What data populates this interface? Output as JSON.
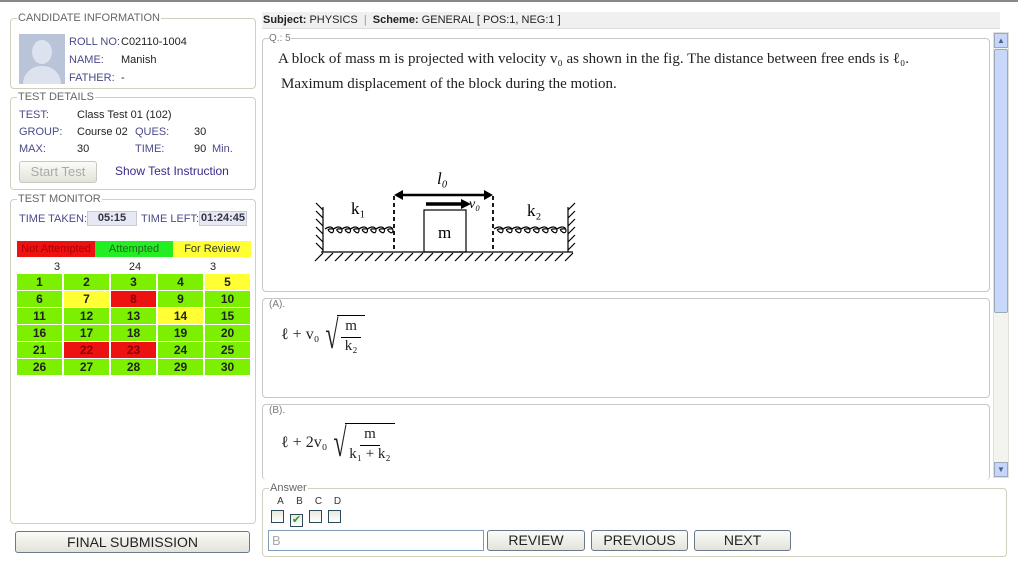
{
  "candidate": {
    "legend": "CANDIDATE INFORMATION",
    "roll_label": "ROLL NO:",
    "roll": "C02110-1004",
    "name_label": "NAME:",
    "name": "Manish",
    "father_label": "FATHER:",
    "father": "-"
  },
  "test": {
    "legend": "TEST DETAILS",
    "test_label": "TEST:",
    "test": "Class Test 01 (102)",
    "group_label": "GROUP:",
    "group": "Course 02",
    "ques_label": "QUES:",
    "ques": "30",
    "max_label": "MAX:",
    "max": "30",
    "time_label": "TIME:",
    "time": "90",
    "time_unit": "Min.",
    "start_button": "Start Test",
    "instruction_link": "Show Test Instruction"
  },
  "monitor": {
    "legend": "TEST MONITOR",
    "taken_label": "TIME TAKEN:",
    "taken": "05:15",
    "left_label": "TIME LEFT:",
    "left": "01:24:45",
    "legend_items": [
      {
        "label": "Not Attempted",
        "count": "3",
        "color": "#ee1111"
      },
      {
        "label": "Attempted",
        "count": "24",
        "color": "#22ee22"
      },
      {
        "label": "For Review",
        "count": "3",
        "color": "#ffff33"
      }
    ],
    "questions": [
      {
        "n": "1",
        "s": "g"
      },
      {
        "n": "2",
        "s": "g"
      },
      {
        "n": "3",
        "s": "g"
      },
      {
        "n": "4",
        "s": "g"
      },
      {
        "n": "5",
        "s": "y"
      },
      {
        "n": "6",
        "s": "g"
      },
      {
        "n": "7",
        "s": "y"
      },
      {
        "n": "8",
        "s": "r"
      },
      {
        "n": "9",
        "s": "g"
      },
      {
        "n": "10",
        "s": "g"
      },
      {
        "n": "11",
        "s": "g"
      },
      {
        "n": "12",
        "s": "g"
      },
      {
        "n": "13",
        "s": "g"
      },
      {
        "n": "14",
        "s": "y"
      },
      {
        "n": "15",
        "s": "g"
      },
      {
        "n": "16",
        "s": "g"
      },
      {
        "n": "17",
        "s": "g"
      },
      {
        "n": "18",
        "s": "g"
      },
      {
        "n": "19",
        "s": "g"
      },
      {
        "n": "20",
        "s": "g"
      },
      {
        "n": "21",
        "s": "g"
      },
      {
        "n": "22",
        "s": "r"
      },
      {
        "n": "23",
        "s": "r"
      },
      {
        "n": "24",
        "s": "g"
      },
      {
        "n": "25",
        "s": "g"
      },
      {
        "n": "26",
        "s": "g"
      },
      {
        "n": "27",
        "s": "g"
      },
      {
        "n": "28",
        "s": "g"
      },
      {
        "n": "29",
        "s": "g"
      },
      {
        "n": "30",
        "s": "g"
      }
    ]
  },
  "final_submission": "FINAL SUBMISSION",
  "header": {
    "subject_label": "Subject:",
    "subject": "PHYSICS",
    "sep": "|",
    "scheme_label": "Scheme:",
    "scheme": "GENERAL [ POS:1, NEG:1 ]"
  },
  "question": {
    "label": "Q.: 5",
    "line1": "A block of mass m is projected with velocity v₀ as shown in the fig. The distance between free ends is ℓ₀.",
    "line2": "Maximum displacement of the block during the motion.",
    "figure": {
      "l0": "l₀",
      "v0": "v₀",
      "k1": "k₁",
      "k2": "k₂",
      "m": "m"
    }
  },
  "options": [
    {
      "label": "(A).",
      "lead": "ℓ + v₀",
      "num": "m",
      "den": "k₂"
    },
    {
      "label": "(B).",
      "lead": "ℓ + 2v₀",
      "num": "m",
      "den": "k₁ + k₂"
    }
  ],
  "answer": {
    "legend": "Answer",
    "choices": [
      "A",
      "B",
      "C",
      "D"
    ],
    "checked": [
      false,
      true,
      false,
      false
    ],
    "value": "B",
    "review": "REVIEW",
    "previous": "PREVIOUS",
    "next": "NEXT"
  }
}
